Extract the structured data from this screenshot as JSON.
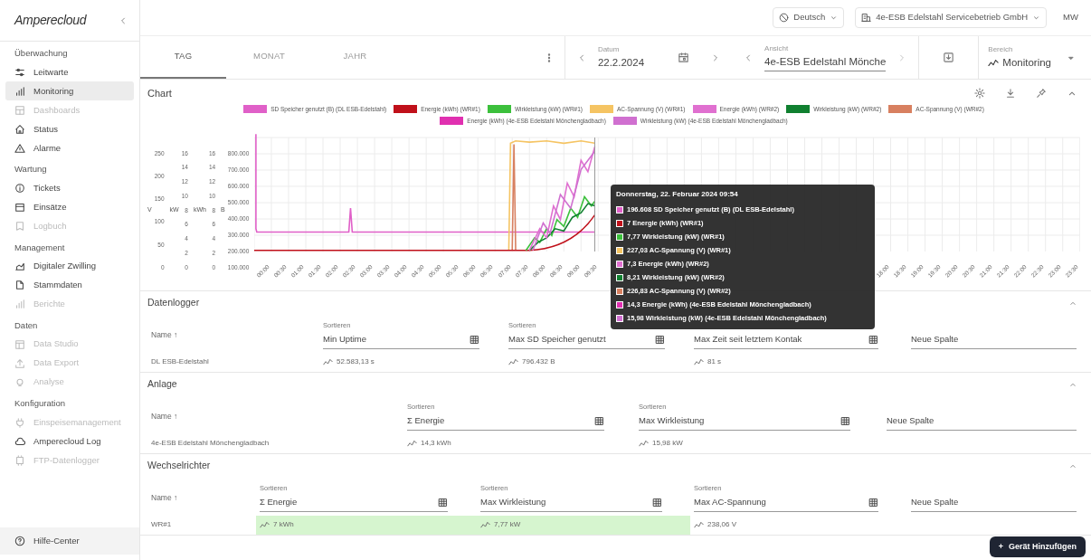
{
  "sidebar": {
    "logo": "Amperecloud",
    "sections": [
      {
        "title": "Überwachung",
        "items": [
          {
            "label": "Leitwarte",
            "selected": false,
            "disabled": false
          },
          {
            "label": "Monitoring",
            "selected": true,
            "disabled": false
          },
          {
            "label": "Dashboards",
            "selected": false,
            "disabled": true
          },
          {
            "label": "Status",
            "selected": false,
            "disabled": false
          },
          {
            "label": "Alarme",
            "selected": false,
            "disabled": false
          }
        ]
      },
      {
        "title": "Wartung",
        "items": [
          {
            "label": "Tickets",
            "selected": false,
            "disabled": false
          },
          {
            "label": "Einsätze",
            "selected": false,
            "disabled": false
          },
          {
            "label": "Logbuch",
            "selected": false,
            "disabled": true
          }
        ]
      },
      {
        "title": "Management",
        "items": [
          {
            "label": "Digitaler Zwilling",
            "selected": false,
            "disabled": false
          },
          {
            "label": "Stammdaten",
            "selected": false,
            "disabled": false
          },
          {
            "label": "Berichte",
            "selected": false,
            "disabled": true
          }
        ]
      },
      {
        "title": "Daten",
        "items": [
          {
            "label": "Data Studio",
            "selected": false,
            "disabled": true
          },
          {
            "label": "Data Export",
            "selected": false,
            "disabled": true
          },
          {
            "label": "Analyse",
            "selected": false,
            "disabled": true
          }
        ]
      },
      {
        "title": "Konfiguration",
        "items": [
          {
            "label": "Einspeisemanagement",
            "selected": false,
            "disabled": true
          },
          {
            "label": "Amperecloud Log",
            "selected": false,
            "disabled": false
          },
          {
            "label": "FTP-Datenlogger",
            "selected": false,
            "disabled": true
          }
        ]
      }
    ],
    "help": "Hilfe-Center"
  },
  "topbar": {
    "language": "Deutsch",
    "company": "4e-ESB Edelstahl Servicebetrieb GmbH",
    "avatar": "MW"
  },
  "tabs": [
    {
      "label": "TAG",
      "selected": true
    },
    {
      "label": "MONAT",
      "selected": false
    },
    {
      "label": "JAHR",
      "selected": false
    }
  ],
  "date": {
    "label": "Datum",
    "value": "22.2.2024"
  },
  "view": {
    "label": "Ansicht",
    "value": "4e-ESB Edelstahl Mönche"
  },
  "area": {
    "label": "Bereich",
    "value": "Monitoring"
  },
  "chart": {
    "title": "Chart",
    "legend": [
      {
        "label": "SD Speicher genutzt (B) (DL ESB-Edelstahl)",
        "color": "#e060c8"
      },
      {
        "label": "Energie (kWh) (WR#1)",
        "color": "#c0101a"
      },
      {
        "label": "Wirkleistung (kW) (WR#1)",
        "color": "#3cc03c"
      },
      {
        "label": "AC-Spannung (V) (WR#1)",
        "color": "#f5c463"
      },
      {
        "label": "Energie (kWh) (WR#2)",
        "color": "#e070d0"
      },
      {
        "label": "Wirkleistung (kW) (WR#2)",
        "color": "#108030"
      },
      {
        "label": "AC-Spannung (V) (WR#2)",
        "color": "#d88060"
      },
      {
        "label": "Energie (kWh) (4e-ESB Edelstahl Mönchengladbach)",
        "color": "#e030b0"
      },
      {
        "label": "Wirkleistung (kW) (4e-ESB Edelstahl Mönchengladbach)",
        "color": "#d070d0"
      }
    ],
    "axes": [
      {
        "title": "V",
        "ticks": [
          "250",
          "200",
          "150",
          "100",
          "50",
          "0"
        ]
      },
      {
        "title": "kW",
        "ticks": [
          "16",
          "14",
          "12",
          "10",
          "8",
          "6",
          "4",
          "2",
          "0"
        ]
      },
      {
        "title": "kWh",
        "ticks": [
          "16",
          "14",
          "12",
          "10",
          "8",
          "6",
          "4",
          "2",
          "0"
        ]
      },
      {
        "title": "B",
        "ticks": [
          "800.000",
          "700.000",
          "600.000",
          "500.000",
          "400.000",
          "300.000",
          "200.000",
          "100.000"
        ]
      }
    ],
    "x_labels_left": [
      "00:00",
      "00:30",
      "01:00",
      "01:30",
      "02:00",
      "02:30",
      "03:00",
      "03:30",
      "04:00",
      "04:30",
      "05:00",
      "05:30",
      "06:00",
      "06:30",
      "07:00",
      "07:30",
      "08:00",
      "08:30",
      "09:00",
      "09:30"
    ],
    "x_labels_right": [
      "18:00",
      "18:30",
      "19:00",
      "19:30",
      "20:00",
      "20:30",
      "21:00",
      "21:30",
      "22:00",
      "22:30",
      "23:00",
      "23:30"
    ],
    "tooltip": {
      "title": "Donnerstag, 22. Februar 2024 09:54",
      "lines": [
        {
          "text": "196.608 SD Speicher genutzt (B) (DL ESB-Edelstahl)",
          "color": "#e060c8"
        },
        {
          "text": "7 Energie (kWh) (WR#1)",
          "color": "#c0101a"
        },
        {
          "text": "7,77 Wirkleistung (kW) (WR#1)",
          "color": "#3cc03c"
        },
        {
          "text": "227,03 AC-Spannung (V) (WR#1)",
          "color": "#f5c463"
        },
        {
          "text": "7,3 Energie (kWh) (WR#2)",
          "color": "#e070d0"
        },
        {
          "text": "8,21 Wirkleistung (kW) (WR#2)",
          "color": "#108030"
        },
        {
          "text": "226,83 AC-Spannung (V) (WR#2)",
          "color": "#d88060"
        },
        {
          "text": "14,3 Energie (kWh) (4e-ESB Edelstahl Mönchengladbach)",
          "color": "#e030b0"
        },
        {
          "text": "15,98 Wirkleistung (kW) (4e-ESB Edelstahl Mönchengladbach)",
          "color": "#d070d0"
        }
      ]
    }
  },
  "sections": [
    {
      "title": "Datenlogger",
      "expanded": true,
      "name_header": "Name ↑",
      "columns": [
        {
          "kind": "metric",
          "sort_label": "Sortieren",
          "field": "Min Uptime"
        },
        {
          "kind": "metric",
          "sort_label": "Sortieren",
          "field": "Max SD Speicher genutzt"
        },
        {
          "kind": "metric",
          "field": "Max Zeit seit letztem Kontak"
        },
        {
          "kind": "new",
          "field": "Neue Spalte"
        }
      ],
      "rows": [
        {
          "name": "DL ESB-Edelstahl",
          "cells": [
            {
              "value": "52.583,13 s",
              "highlighted": false
            },
            {
              "value": "796.432 B",
              "highlighted": false
            },
            {
              "value": "81 s",
              "highlighted": false
            }
          ]
        }
      ]
    },
    {
      "title": "Anlage",
      "expanded": true,
      "name_header": "Name ↑",
      "columns": [
        {
          "kind": "metric",
          "sort_label": "Sortieren",
          "field": "Σ Energie"
        },
        {
          "kind": "metric",
          "sort_label": "Sortieren",
          "field": "Max Wirkleistung"
        },
        {
          "kind": "new",
          "field": "Neue Spalte"
        }
      ],
      "rows": [
        {
          "name": "4e-ESB Edelstahl Mönchengladbach",
          "cells": [
            {
              "value": "14,3 kWh",
              "highlighted": false
            },
            {
              "value": "15,98 kW",
              "highlighted": false
            }
          ]
        }
      ]
    },
    {
      "title": "Wechselrichter",
      "expanded": true,
      "name_header": "Name ↑",
      "columns": [
        {
          "kind": "metric",
          "sort_label": "Sortieren",
          "field": "Σ Energie"
        },
        {
          "kind": "metric",
          "sort_label": "Sortieren",
          "field": "Max Wirkleistung"
        },
        {
          "kind": "metric",
          "sort_label": "Sortieren",
          "field": "Max AC-Spannung"
        },
        {
          "kind": "new",
          "field": "Neue Spalte"
        }
      ],
      "rows": [
        {
          "name": "WR#1",
          "cells": [
            {
              "value": "7 kWh",
              "highlighted": true
            },
            {
              "value": "7,77 kW",
              "highlighted": true
            },
            {
              "value": "238,06 V",
              "highlighted": false
            }
          ]
        }
      ]
    }
  ],
  "fab": {
    "plus": "+",
    "label": "Gerät Hinzufügen"
  }
}
